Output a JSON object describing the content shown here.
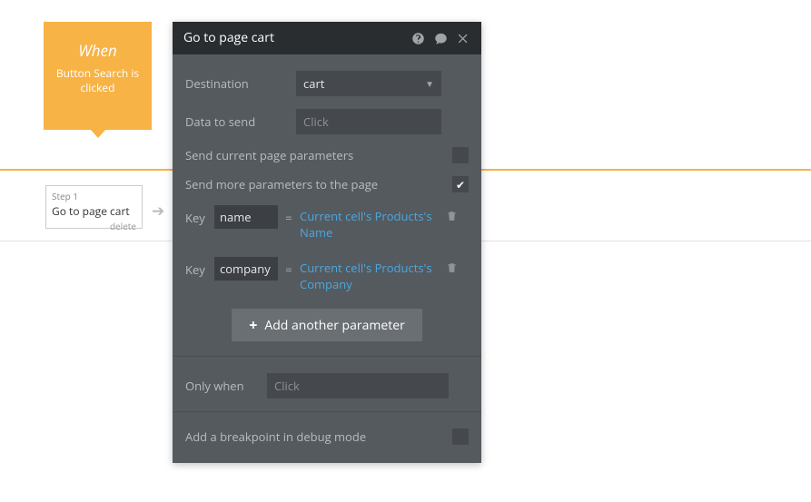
{
  "trigger": {
    "title": "When",
    "subtitle": "Button Search is clicked"
  },
  "strip": {
    "step_label": "Step 1",
    "step_name": "Go to page cart",
    "delete": "delete",
    "arrow": "➔"
  },
  "panel": {
    "title": "Go to page cart",
    "destination_label": "Destination",
    "destination_value": "cart",
    "data_label": "Data to send",
    "data_placeholder": "Click",
    "send_current_label": "Send current page parameters",
    "send_more_label": "Send more parameters to the page",
    "send_more_checked": "✔",
    "key_label": "Key",
    "eq": "=",
    "params": [
      {
        "key": "name",
        "expr": "Current cell's Products's Name"
      },
      {
        "key": "company",
        "expr": "Current cell's Products's Company"
      }
    ],
    "add_param": "Add another parameter",
    "only_when_label": "Only when",
    "only_when_placeholder": "Click",
    "breakpoint_label": "Add a breakpoint in debug mode"
  }
}
